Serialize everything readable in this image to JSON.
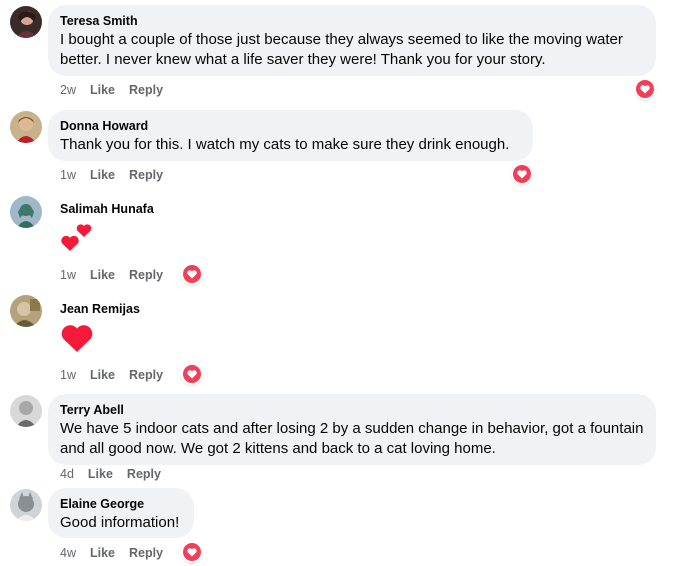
{
  "colors": {
    "bubble": "#f0f2f5",
    "meta": "#65676b",
    "heart": "#f33e58"
  },
  "comments": [
    {
      "author": "Teresa Smith",
      "text": "I bought a couple of those just because they always seemed to like the moving water better. I never knew what a life saver they were! Thank you for your story.",
      "age": "2w",
      "like": "Like",
      "reply": "Reply",
      "reaction": "love-icon"
    },
    {
      "author": "Donna Howard",
      "text": "Thank you for this. I watch my cats to make sure they drink enough.",
      "age": "1w",
      "like": "Like",
      "reply": "Reply",
      "reaction": "love-icon"
    },
    {
      "author": "Salimah Hunafa",
      "text": "",
      "emoji": "two-hearts-icon",
      "age": "1w",
      "like": "Like",
      "reply": "Reply",
      "reaction": "love-icon"
    },
    {
      "author": "Jean Remijas",
      "text": "",
      "emoji": "red-heart-icon",
      "age": "1w",
      "like": "Like",
      "reply": "Reply",
      "reaction": "love-icon"
    },
    {
      "author": "Terry Abell",
      "text": "We have 5 indoor cats and after losing 2 by a sudden change in behavior, got a fountain and all good now. We got 2 kittens and back to a cat loving home.",
      "age": "4d",
      "like": "Like",
      "reply": "Reply",
      "reaction": ""
    },
    {
      "author": "Elaine George",
      "text": "Good information!",
      "age": "4w",
      "like": "Like",
      "reply": "Reply",
      "reaction": "love-icon"
    }
  ]
}
